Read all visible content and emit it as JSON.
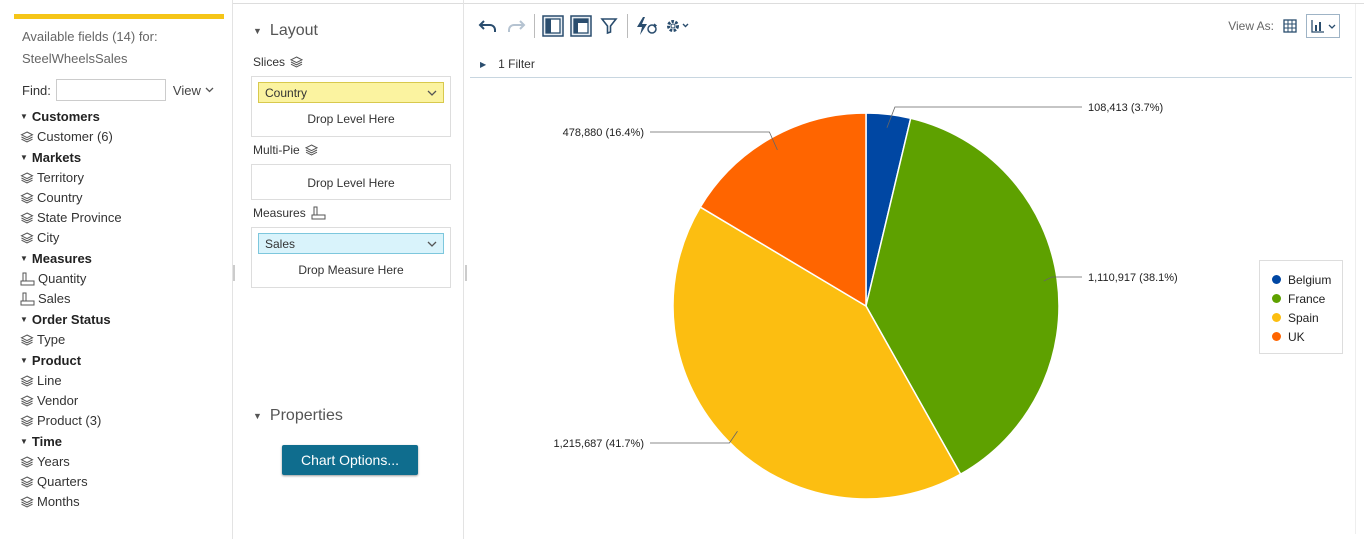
{
  "fields_panel": {
    "available_line1": "Available fields (14) for:",
    "available_line2": "SteelWheelsSales",
    "find_label": "Find:",
    "view_label": "View",
    "groups": [
      {
        "name": "Customers",
        "items": [
          "Customer (6)"
        ]
      },
      {
        "name": "Markets",
        "items": [
          "Territory",
          "Country",
          "State Province",
          "City"
        ]
      },
      {
        "name": "Measures",
        "items": [
          "Quantity",
          "Sales"
        ],
        "measure": true
      },
      {
        "name": "Order Status",
        "items": [
          "Type"
        ]
      },
      {
        "name": "Product",
        "items": [
          "Line",
          "Vendor",
          "Product (3)"
        ]
      },
      {
        "name": "Time",
        "items": [
          "Years",
          "Quarters",
          "Months"
        ]
      }
    ]
  },
  "layout_panel": {
    "title": "Layout",
    "slices_label": "Slices",
    "slices_value": "Country",
    "drop_level": "Drop Level Here",
    "multipie_label": "Multi-Pie",
    "multipie_drop": "Drop Level Here",
    "measures_label": "Measures",
    "measures_value": "Sales",
    "drop_measure": "Drop Measure Here",
    "properties_title": "Properties",
    "chart_options_button": "Chart Options..."
  },
  "toolbar": {
    "view_as_label": "View As:",
    "filter_text": "1 Filter"
  },
  "colors": {
    "Belgium": "#0047a3",
    "France": "#5ea100",
    "Spain": "#fcbe11",
    "UK": "#ff6500",
    "accent": "#f5c518",
    "button": "#0f6d8e"
  },
  "chart_data": {
    "type": "pie",
    "title": "",
    "slices": [
      {
        "label": "Belgium",
        "value": 108413,
        "percent": "3.7%",
        "display": "108,413 (3.7%)"
      },
      {
        "label": "France",
        "value": 1110917,
        "percent": "38.1%",
        "display": "1,110,917 (38.1%)"
      },
      {
        "label": "Spain",
        "value": 1215687,
        "percent": "41.7%",
        "display": "1,215,687 (41.7%)"
      },
      {
        "label": "UK",
        "value": 478880,
        "percent": "16.4%",
        "display": "478,880 (16.4%)"
      }
    ],
    "legend": [
      "Belgium",
      "France",
      "Spain",
      "UK"
    ],
    "legend_position": "right"
  }
}
